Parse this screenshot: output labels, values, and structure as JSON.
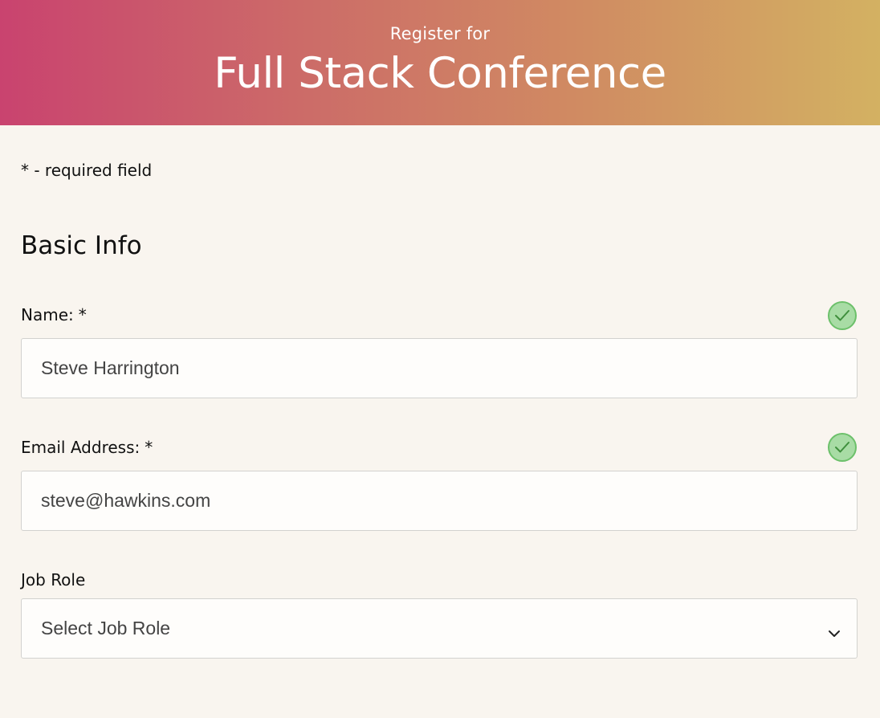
{
  "header": {
    "subtitle": "Register for",
    "title": "Full Stack Conference"
  },
  "required_note": "* - required field",
  "section": {
    "title": "Basic Info"
  },
  "fields": {
    "name": {
      "label": "Name:",
      "required_marker": "*",
      "value": "Steve Harrington",
      "valid": true
    },
    "email": {
      "label": "Email Address:",
      "required_marker": "*",
      "value": "steve@hawkins.com",
      "valid": true
    },
    "job_role": {
      "label": "Job Role",
      "selected": "Select Job Role"
    }
  },
  "icons": {
    "valid": "check-circle-icon",
    "dropdown": "chevron-down-icon"
  },
  "colors": {
    "gradient_start": "#c9436f",
    "gradient_end": "#d3b162",
    "background": "#f9f5ef",
    "valid_green": "#6cc06a"
  }
}
